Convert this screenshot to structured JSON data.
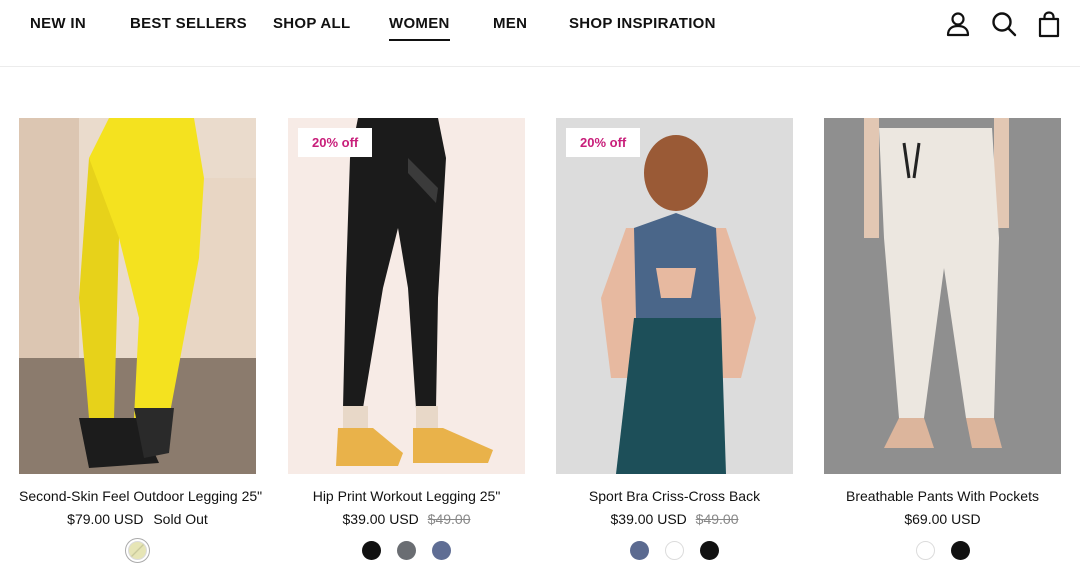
{
  "nav": {
    "items": [
      {
        "label": "NEW IN"
      },
      {
        "label": "BEST SELLERS"
      },
      {
        "label": "SHOP ALL"
      },
      {
        "label": "WOMEN",
        "active": true
      },
      {
        "label": "MEN"
      },
      {
        "label": "SHOP INSPIRATION"
      }
    ],
    "icons": [
      "account-icon",
      "search-icon",
      "cart-icon"
    ]
  },
  "products": [
    {
      "title": "Second-Skin Feel Outdoor Legging 25\"",
      "price": "$79.00 USD",
      "compare_price": "",
      "status": "Sold Out",
      "badge": "",
      "swatches": [
        "#d9d8a6"
      ]
    },
    {
      "title": "Hip Print Workout Legging 25\"",
      "price": "$39.00 USD",
      "compare_price": "$49.00",
      "status": "",
      "badge": "20% off",
      "swatches": [
        "#111111",
        "#6a6d72",
        "#5f6d94"
      ]
    },
    {
      "title": "Sport Bra Criss-Cross Back",
      "price": "$39.00 USD",
      "compare_price": "$49.00",
      "status": "",
      "badge": "20% off",
      "swatches": [
        "#5b6a90",
        "#ffffff",
        "#111111"
      ]
    },
    {
      "title": "Breathable Pants With Pockets",
      "price": "$69.00 USD",
      "compare_price": "",
      "status": "",
      "badge": "",
      "swatches": [
        "#ffffff",
        "#111111"
      ]
    }
  ],
  "colors": {
    "badge_text": "#c81e7a",
    "nav_text": "#111111"
  }
}
